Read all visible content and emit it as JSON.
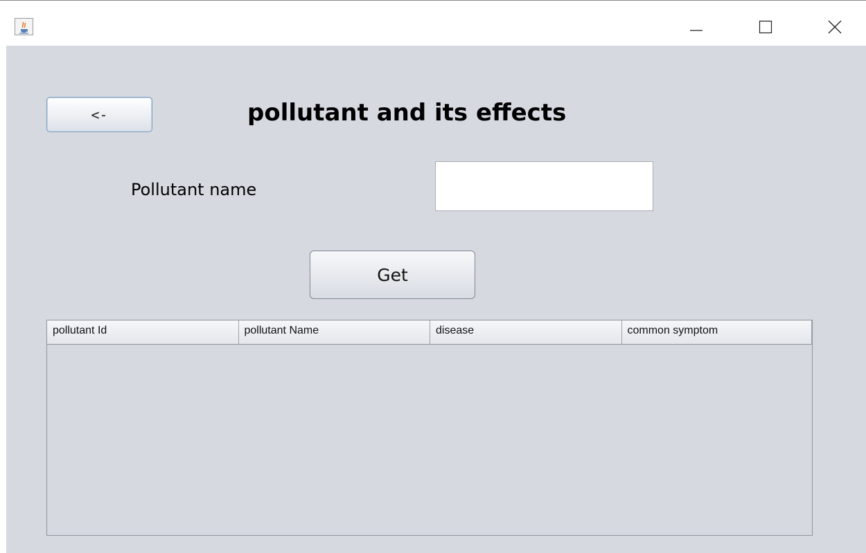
{
  "window": {
    "app_icon": "java-coffee-cup-icon",
    "controls": [
      "minimize-icon",
      "maximize-icon",
      "close-icon"
    ]
  },
  "header": {
    "back_label": "<-",
    "title": "pollutant and its effects"
  },
  "form": {
    "pollutant_name_label": "Pollutant name",
    "pollutant_name_value": "",
    "get_label": "Get"
  },
  "table": {
    "columns": [
      "pollutant Id",
      "pollutant Name",
      "disease",
      "common symptom"
    ],
    "rows": []
  },
  "colors": {
    "panel_background": "#d6d9e0",
    "titlebar_background": "#ffffff"
  }
}
